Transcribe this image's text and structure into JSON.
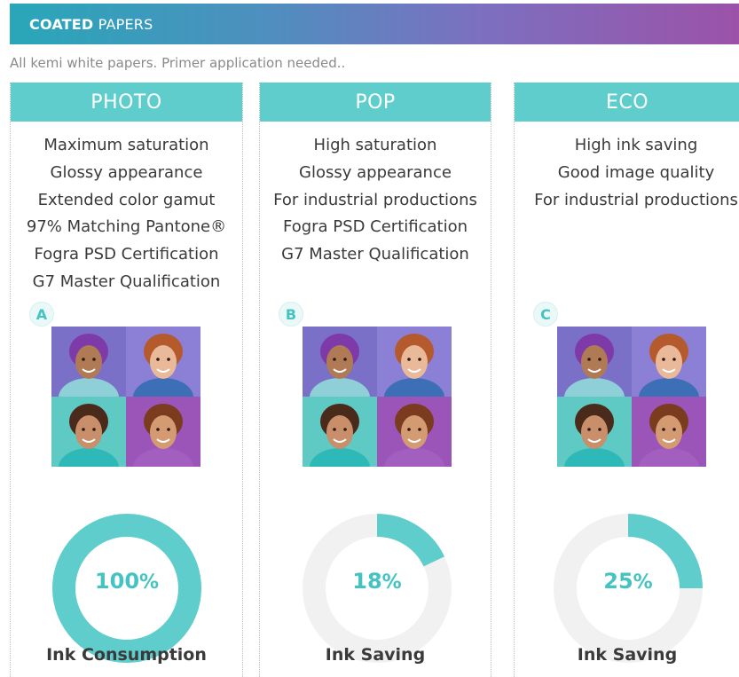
{
  "banner": {
    "bold": "COATED",
    "rest": " PAPERS"
  },
  "subtitle": "All kemi white papers. Primer application needed..",
  "columns": [
    {
      "title": "PHOTO",
      "features": [
        "Maximum saturation",
        "Glossy appearance",
        "Extended color gamut",
        "97% Matching Pantone®",
        "Fogra PSD Certification",
        "G7 Master Qualification"
      ],
      "badge": "A",
      "value": 100,
      "value_label": "100",
      "value_unit": "%",
      "metric": "Ink Consumption"
    },
    {
      "title": "POP",
      "features": [
        "High saturation",
        "Glossy appearance",
        "For industrial productions",
        "Fogra PSD Certification",
        "G7 Master Qualification"
      ],
      "badge": "B",
      "value": 18,
      "value_label": "18",
      "value_unit": "%",
      "metric": "Ink Saving"
    },
    {
      "title": "ECO",
      "features": [
        "High ink saving",
        "Good image quality",
        "For industrial productions"
      ],
      "badge": "C",
      "value": 25,
      "value_label": "25",
      "value_unit": "%",
      "metric": "Ink Saving"
    }
  ],
  "colors": {
    "accent": "#5ecdcb",
    "track": "#f1f1f1"
  }
}
